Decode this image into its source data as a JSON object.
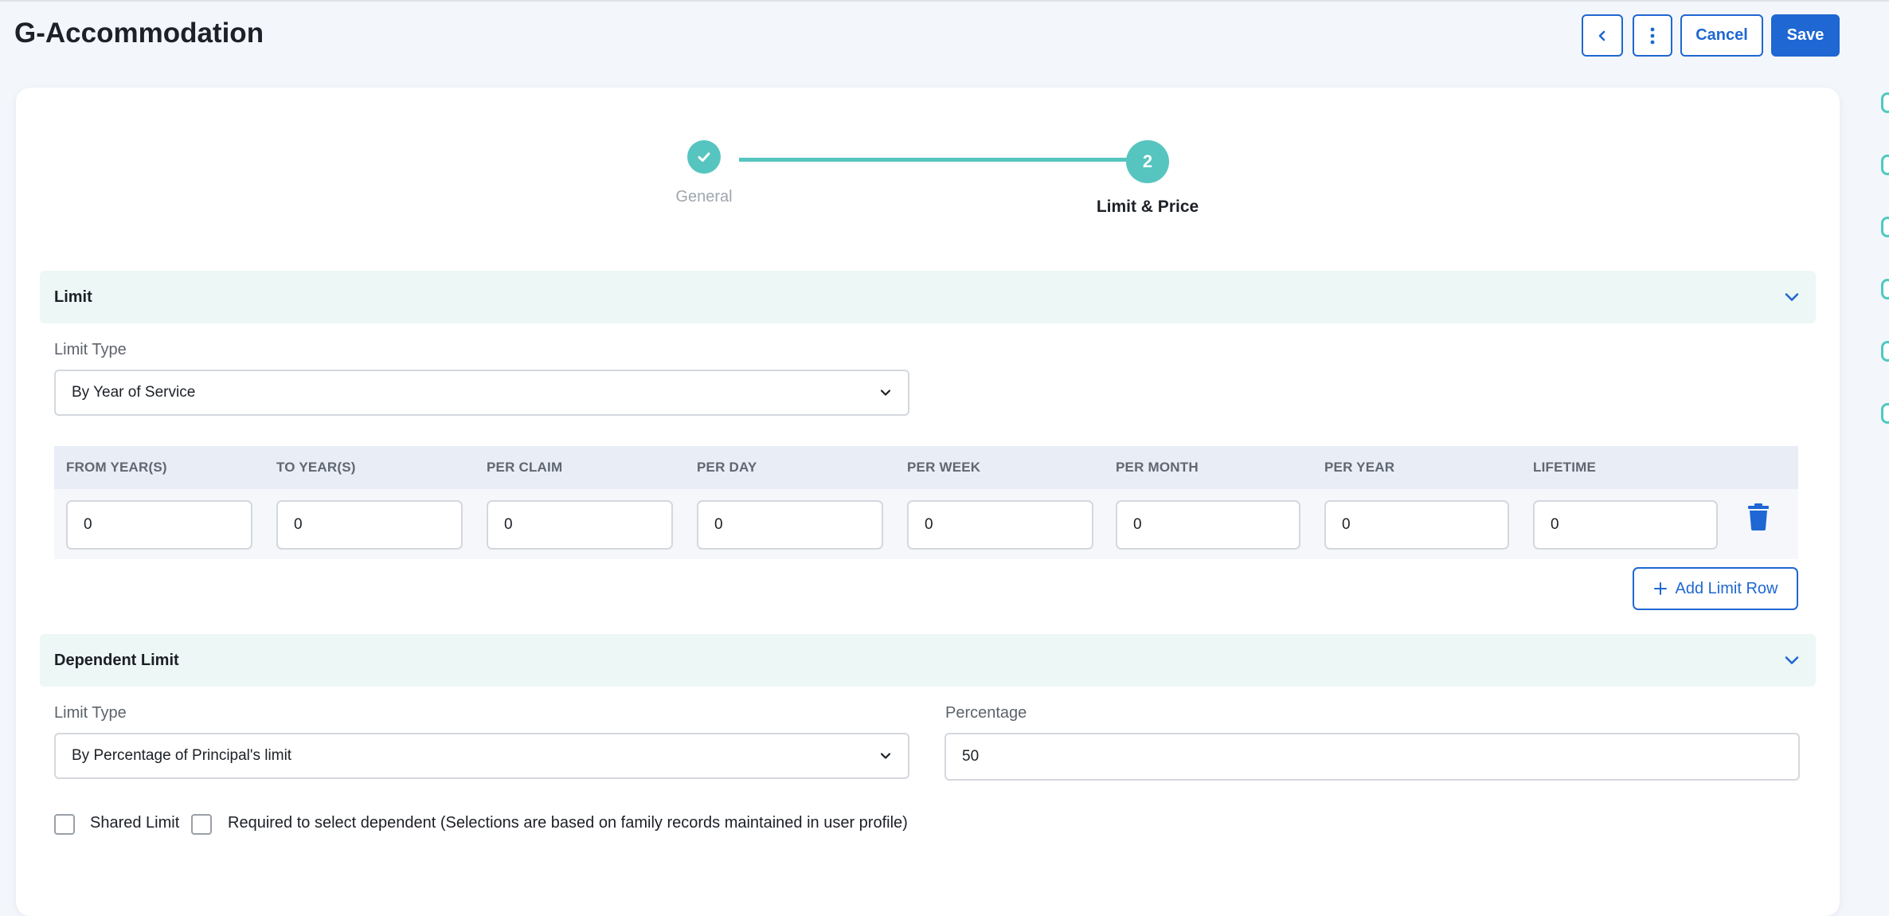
{
  "header": {
    "title": "G-Accommodation",
    "back_icon": "chevron-left-icon",
    "more_icon": "vertical-dots-icon",
    "cancel_label": "Cancel",
    "save_label": "Save"
  },
  "colors": {
    "primary": "#1f67d2",
    "accent_teal": "#56c5bf",
    "section_bg": "#ecf7f6",
    "grid_header_bg": "#e8edf6"
  },
  "stepper": {
    "steps": [
      {
        "label": "General",
        "state": "completed",
        "icon": "check-icon"
      },
      {
        "label": "Limit & Price",
        "number": "2",
        "state": "active"
      }
    ]
  },
  "limit": {
    "section_title": "Limit",
    "limit_type_label": "Limit Type",
    "limit_type_value": "By Year of Service",
    "columns": [
      "FROM YEAR(S)",
      "TO YEAR(S)",
      "PER CLAIM",
      "PER DAY",
      "PER WEEK",
      "PER MONTH",
      "PER YEAR",
      "LIFETIME"
    ],
    "rows": [
      [
        "0",
        "0",
        "0",
        "0",
        "0",
        "0",
        "0",
        "0"
      ]
    ],
    "delete_icon": "trash-icon",
    "add_row_label": "Add Limit Row"
  },
  "dependent_limit": {
    "section_title": "Dependent Limit",
    "limit_type_label": "Limit Type",
    "limit_type_value": "By Percentage of Principal's limit",
    "percentage_label": "Percentage",
    "percentage_value": "50",
    "shared_limit_label": "Shared Limit",
    "shared_limit_checked": false,
    "required_dependent_label": "Required to select dependent (Selections are based on family records maintained in user profile)",
    "required_dependent_checked": false
  }
}
